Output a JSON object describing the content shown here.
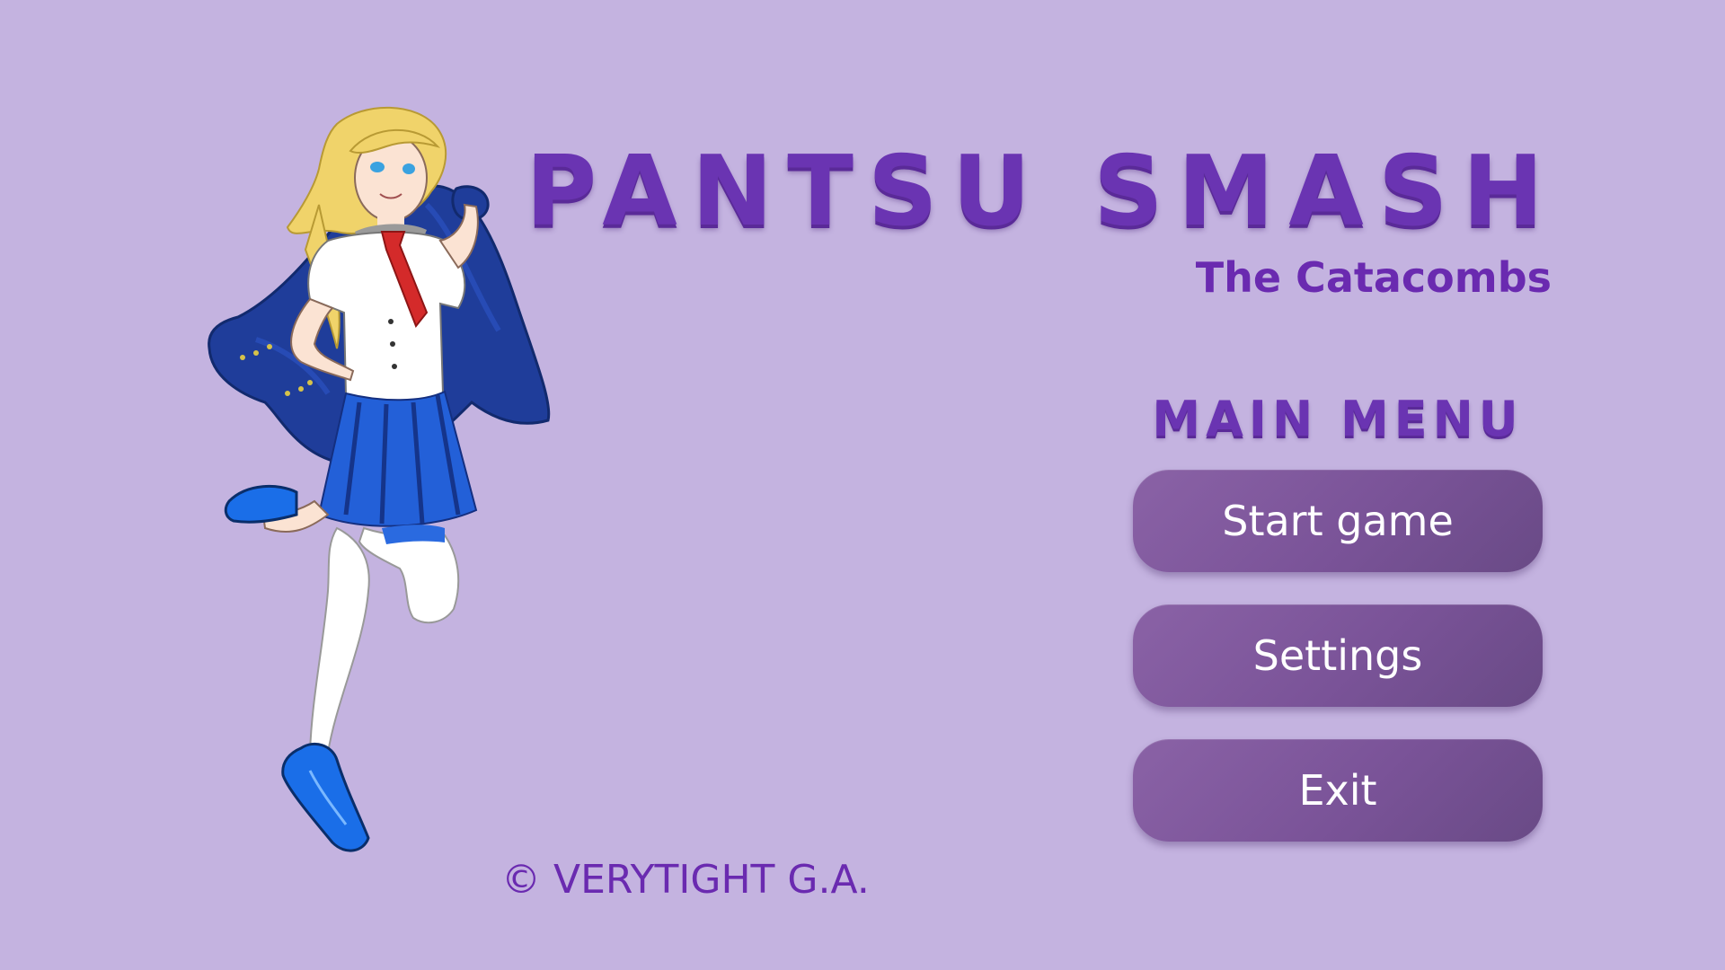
{
  "game": {
    "title": "PANTSU SMASH",
    "subtitle": "The Catacombs"
  },
  "menu": {
    "heading": "MAIN MENU",
    "buttons": {
      "start": "Start game",
      "settings": "Settings",
      "exit": "Exit"
    }
  },
  "footer": {
    "copyright": "© VERYTIGHT G.A."
  },
  "colors": {
    "background": "#c4b3e0",
    "title": "#6a34b2",
    "button": "#7a5398",
    "button_text": "#ffffff"
  },
  "artwork": {
    "character": "schoolgirl-character-illustration"
  }
}
